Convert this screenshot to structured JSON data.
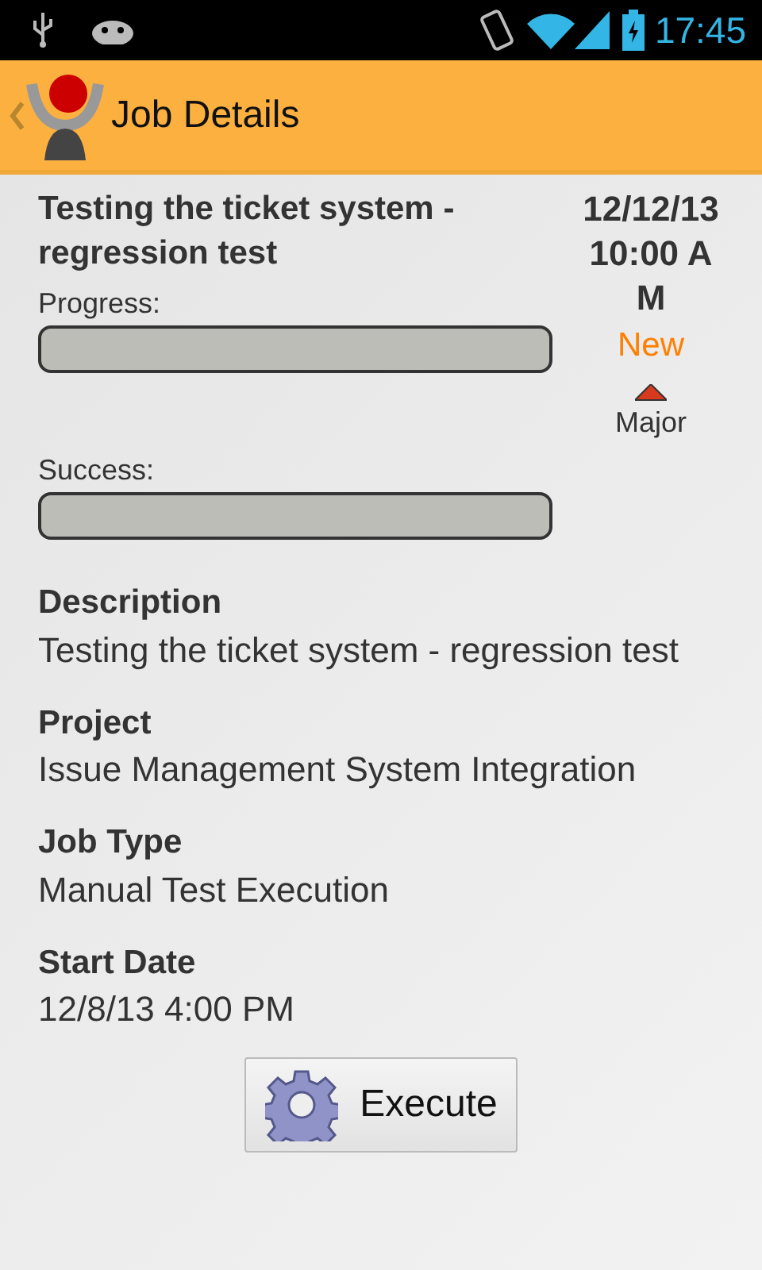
{
  "status_bar": {
    "time": "17:45"
  },
  "action_bar": {
    "title": "Job Details"
  },
  "job": {
    "title": "Testing the ticket system - regression test",
    "date": "12/12/13 10:00 AM",
    "status": {
      "text": "New",
      "color": "#ff7f00"
    },
    "priority": {
      "text": "Major",
      "color": "#d83a1e"
    },
    "meters": [
      {
        "label": "Progress:",
        "level": 0
      },
      {
        "label": "Success:",
        "level": 0
      }
    ]
  },
  "fields": [
    {
      "label": "Description",
      "value": "Testing the ticket system - regression test"
    },
    {
      "label": "Project",
      "value": "Issue Management System Integration"
    },
    {
      "label": "Job Type",
      "value": "Manual Test Execution"
    },
    {
      "label": "Start Date",
      "value": "12/8/13 4:00 PM"
    }
  ],
  "button": {
    "label": "Execute"
  }
}
